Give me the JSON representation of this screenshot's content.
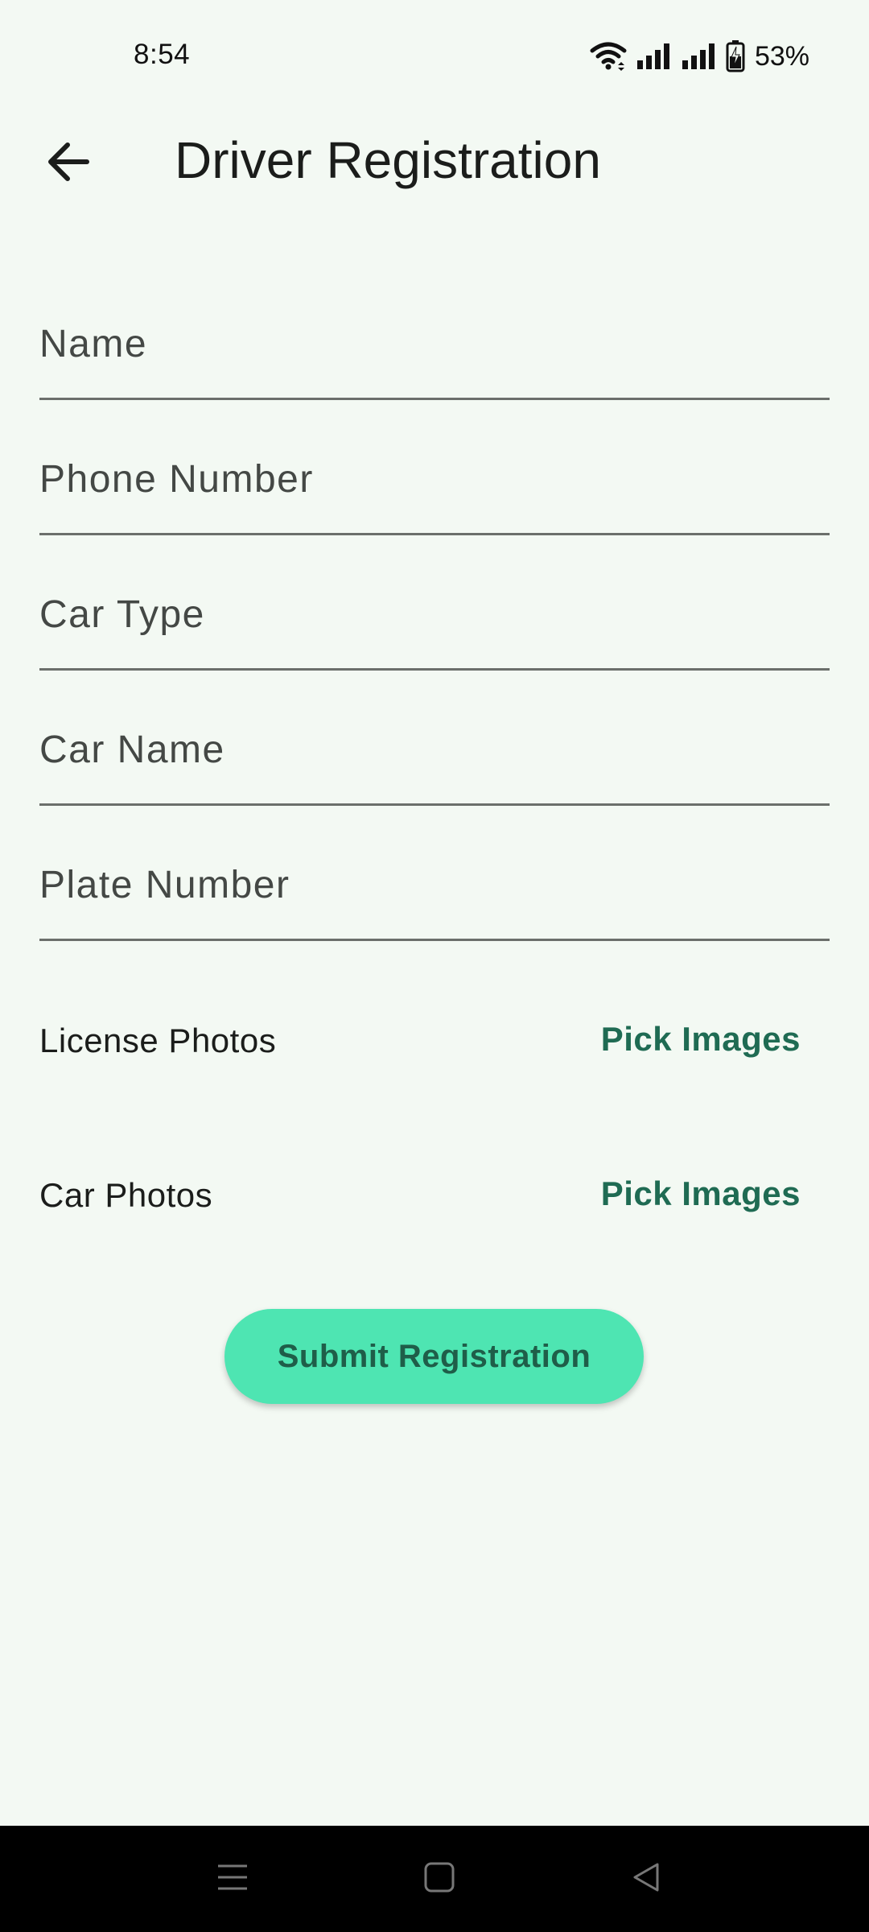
{
  "status_bar": {
    "time": "8:54",
    "battery": "53%",
    "icons": [
      "wifi-icon",
      "signal-icon",
      "signal-icon",
      "battery-charging-icon"
    ]
  },
  "app_bar": {
    "title": "Driver Registration",
    "back_icon": "arrow-back-icon"
  },
  "form": {
    "fields": [
      {
        "placeholder": "Name",
        "value": ""
      },
      {
        "placeholder": "Phone Number",
        "value": ""
      },
      {
        "placeholder": "Car Type",
        "value": ""
      },
      {
        "placeholder": "Car Name",
        "value": ""
      },
      {
        "placeholder": "Plate Number",
        "value": ""
      }
    ],
    "license_photos": {
      "label": "License Photos",
      "button": "Pick Images"
    },
    "car_photos": {
      "label": "Car Photos",
      "button": "Pick Images"
    },
    "submit_label": "Submit Registration"
  },
  "nav_bar": {
    "buttons": [
      "menu-icon",
      "home-icon",
      "back-icon"
    ]
  },
  "colors": {
    "background": "#f3f9f3",
    "accent_button": "#4ee5b2",
    "accent_text": "#1f6b53",
    "field_underline": "#6b6f6b"
  }
}
